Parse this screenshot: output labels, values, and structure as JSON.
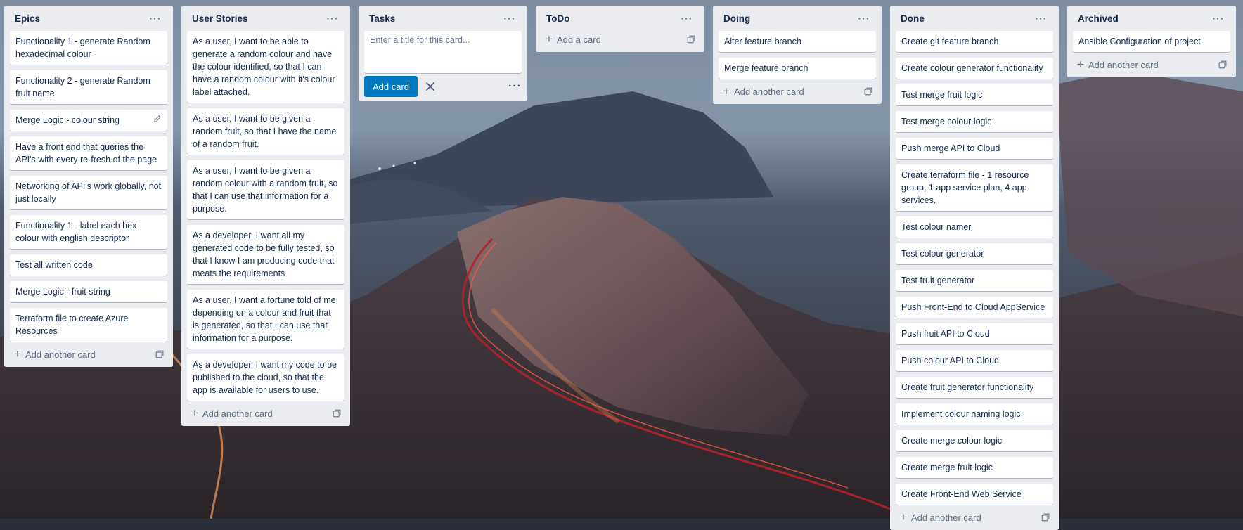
{
  "colors": {
    "list_bg": "#ebecf0",
    "card_bg": "#ffffff",
    "accent": "#0079bf",
    "text": "#172b4d",
    "muted": "#5e6c84"
  },
  "icons": {
    "list_menu": "ellipsis-icon",
    "add": "plus-icon",
    "template": "card-template-icon",
    "edit": "pencil-icon",
    "close": "close-icon"
  },
  "lists": {
    "epics": {
      "title": "Epics",
      "cards": [
        "Functionality 1 - generate Random hexadecimal colour",
        "Functionality 2 - generate Random fruit name",
        "Merge Logic - colour string",
        "Have a front end that queries the API's with every re-fresh of the page",
        "Networking of API's work globally, not just locally",
        "Functionality 1 - label each hex colour with english descriptor",
        "Test all written code",
        "Merge Logic - fruit string",
        "Terraform file to create Azure Resources"
      ],
      "add_label": "Add another card"
    },
    "user_stories": {
      "title": "User Stories",
      "cards": [
        "As a user, I want to be able to generate a random colour and have the colour identified, so that I can have a random colour with it's colour label attached.",
        "As a user, I want to be given a random fruit, so that I have the name of a random fruit.",
        "As a user, I want to be given a random colour with a random fruit, so that I can use that information for a purpose.",
        "As a developer, I want all my generated code to be fully tested, so that I know I am producing code that meats the requirements",
        "As a user, I want a fortune told of me depending on a colour and fruit that is generated, so that I can use that information for a purpose.",
        "As a developer, I want my code to be published to the cloud, so that the app is available for users to use."
      ],
      "add_label": "Add another card"
    },
    "tasks": {
      "title": "Tasks",
      "composer_placeholder": "Enter a title for this card...",
      "add_button": "Add card"
    },
    "todo": {
      "title": "ToDo",
      "add_label": "Add a card"
    },
    "doing": {
      "title": "Doing",
      "cards": [
        "Alter feature branch",
        "Merge feature branch"
      ],
      "add_label": "Add another card"
    },
    "done": {
      "title": "Done",
      "cards": [
        "Create git feature branch",
        "Create colour generator functionality",
        "Test merge fruit logic",
        "Test merge colour logic",
        "Push merge API to Cloud",
        "Create terraform file - 1 resource group, 1 app service plan, 4 app services.",
        "Test colour namer",
        "Test colour generator",
        "Test fruit generator",
        "Push Front-End to Cloud AppService",
        "Push fruit API to Cloud",
        "Push colour API to Cloud",
        "Create fruit generator functionality",
        "Implement colour naming logic",
        "Create merge colour logic",
        "Create merge fruit logic",
        "Create Front-End Web Service"
      ],
      "add_label": "Add another card"
    },
    "archived": {
      "title": "Archived",
      "cards": [
        "Ansible Configuration of project"
      ],
      "add_label": "Add another card"
    }
  }
}
